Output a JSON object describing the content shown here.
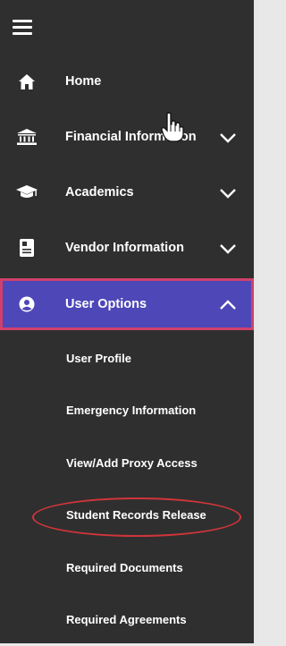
{
  "nav": {
    "menu_icon": "hamburger-icon",
    "items": [
      {
        "label": "Home",
        "icon": "home-icon",
        "expandable": false
      },
      {
        "label": "Financial Information",
        "icon": "bank-icon",
        "expandable": true
      },
      {
        "label": "Academics",
        "icon": "graduation-cap-icon",
        "expandable": true
      },
      {
        "label": "Vendor Information",
        "icon": "document-icon",
        "expandable": true
      },
      {
        "label": "User Options",
        "icon": "user-icon",
        "expandable": true,
        "expanded": true
      }
    ],
    "sub_items": [
      {
        "label": "User Profile"
      },
      {
        "label": "Emergency Information"
      },
      {
        "label": "View/Add Proxy Access"
      },
      {
        "label": "Student Records Release"
      },
      {
        "label": "Required Documents"
      },
      {
        "label": "Required Agreements"
      }
    ]
  },
  "colors": {
    "sidebar_bg": "#2f2f2f",
    "active_bg": "#4d47b8",
    "active_border": "#d0406c",
    "annotation": "#d0353a"
  }
}
